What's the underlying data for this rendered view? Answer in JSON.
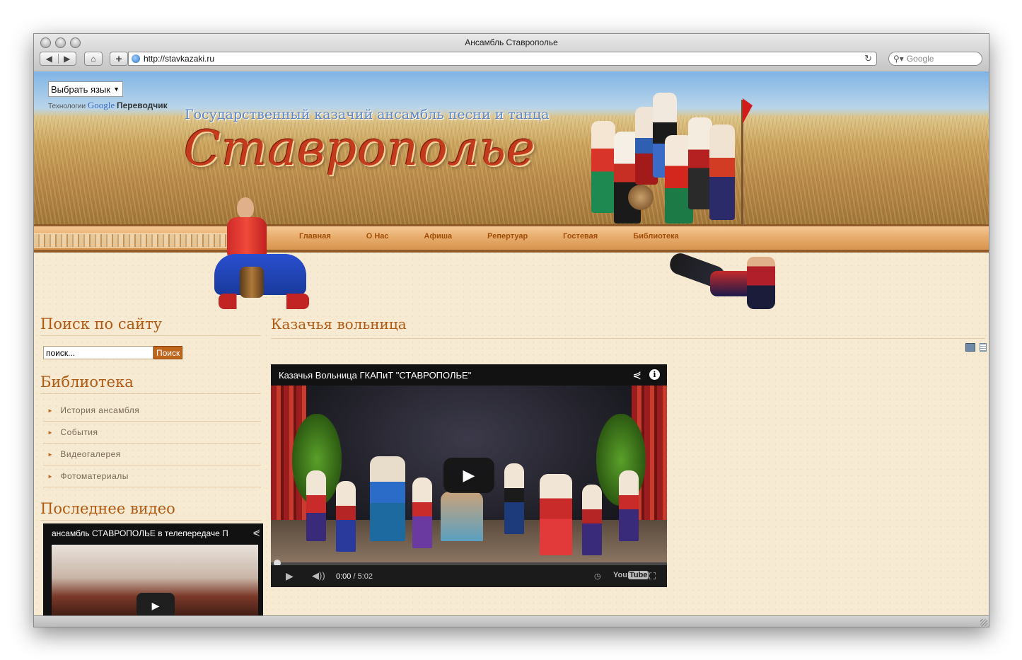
{
  "window": {
    "title": "Ансамбль Ставрополье",
    "url": "http://stavkazaki.ru",
    "search_placeholder": "Google"
  },
  "header": {
    "language_select": "Выбрать язык",
    "google_prefix": "Технологии",
    "google_word": "Google",
    "translator": "Переводчик",
    "subtitle": "Государственный казачий ансамбль песни и танца",
    "brand": "Ставрополье"
  },
  "menu": [
    "Главная",
    "О Нас",
    "Афиша",
    "Репертуар",
    "Гостевая",
    "Библиотека"
  ],
  "sidebar": {
    "search_heading": "Поиск по сайту",
    "search_value": "поиск...",
    "search_button": "Поиск",
    "library_heading": "Библиотека",
    "library_items": [
      "История ансамбля",
      "События",
      "Видеогалерея",
      "Фотоматериалы"
    ],
    "latest_video_heading": "Последнее видео",
    "latest_video_title": "ансамбль СТАВРОПОЛЬЕ в телепередаче П"
  },
  "main": {
    "article_title": "Казачья вольница",
    "video": {
      "title": "Казачья Вольница ГКАПиТ \"СТАВРОПОЛЬЕ\"",
      "time_current": "0:00",
      "time_total": "/ 5:02",
      "yt_you": "You",
      "yt_tube": "Tube"
    }
  },
  "colors": {
    "heading": "#b05a13",
    "menu_text": "#a14e0a",
    "brand": "#c33a1c",
    "page_bg": "#f6ead2"
  }
}
